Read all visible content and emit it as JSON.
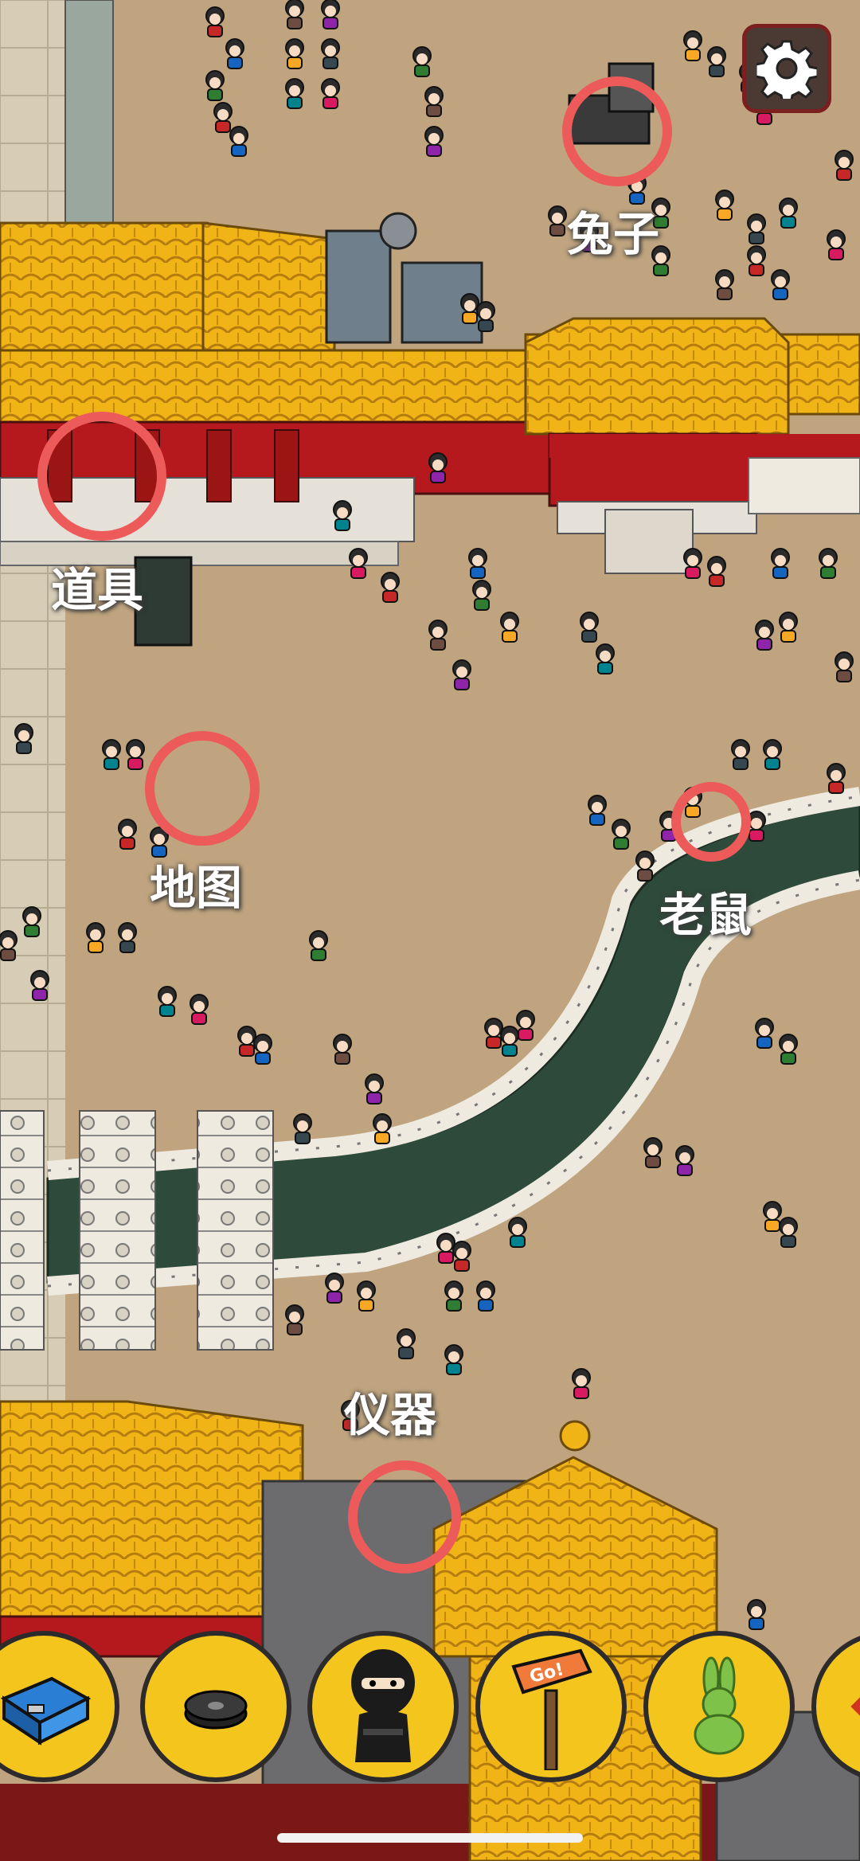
{
  "labels": {
    "rabbit": "兔子",
    "prop": "道具",
    "map": "地图",
    "mouse": "老鼠",
    "instrument": "仪器"
  },
  "colors": {
    "ground": "#bfa47f",
    "roof": "#f1b417",
    "wall_red": "#b5191d",
    "water": "#2e4a3a",
    "marker_ring": "#ec5a5a",
    "tool_bg": "#f3c51d"
  },
  "toolbar": {
    "items": [
      {
        "icon": "toolbox-icon"
      },
      {
        "icon": "hockey-puck-icon"
      },
      {
        "icon": "ninja-icon"
      },
      {
        "icon": "go-signpost-icon"
      },
      {
        "icon": "jade-rabbit-icon"
      },
      {
        "icon": "warning-sign-icon"
      }
    ],
    "signpost_text": "Go!"
  },
  "settings": {
    "icon": "gear-icon"
  }
}
